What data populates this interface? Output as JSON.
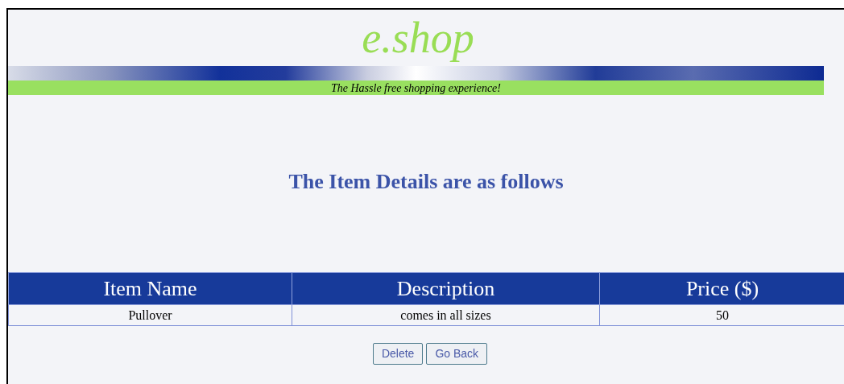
{
  "logo": "e.shop",
  "tagline": "The Hassle free shopping experience!",
  "heading": "The Item Details are as follows",
  "table": {
    "columns": [
      "Item Name",
      "Description",
      "Price ($)"
    ],
    "rows": [
      [
        "Pullover",
        "comes in all sizes",
        "50"
      ]
    ]
  },
  "buttons": [
    "Delete",
    "Go Back"
  ]
}
